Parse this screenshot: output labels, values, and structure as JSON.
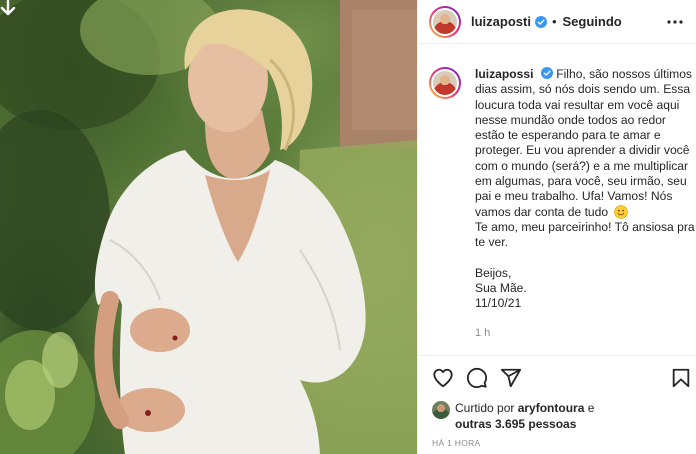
{
  "photo": {
    "alt_subject": "",
    "download_icon": "download-arrow-icon"
  },
  "post": {
    "username": "luizaposti",
    "follow_state": "Seguindo",
    "separator": "•",
    "verified_icon": "verified-badge-icon",
    "more_icon": "more-options-icon",
    "accent_color": "#3897f0"
  },
  "caption": {
    "username": "luizapossi",
    "lines": [
      " Filho, são nossos últimos",
      "dias assim, só nós dois sendo um. Essa",
      "loucura toda vai resultar em você aqui",
      "nesse mundão onde todos ao redor",
      "estão te esperando para te amar e",
      "proteger. Eu vou aprender a dividir você",
      "com o mundo (será?) e a me multiplicar",
      "em algumas, para você, seu irmão, seu",
      "pai e meu trabalho. Ufa! Vamos! Nós",
      "vamos dar conta de tudo",
      "Te amo, meu parceirinho! Tô ansiosa pra",
      "te ver."
    ],
    "sign_off": [
      "Beijos,",
      "Sua Mãe.",
      "11/10/21"
    ],
    "time_ago": "1 h",
    "emoji_icon": "smiling-face-emoji-icon"
  },
  "actions": {
    "like_icon": "heart-icon",
    "comment_icon": "comment-bubble-icon",
    "share_icon": "paper-plane-icon",
    "save_icon": "bookmark-icon"
  },
  "likes": {
    "prefix": "Curtido por ",
    "liker": "aryfontoura",
    "middle": " e",
    "others": "outras 3.695 pessoas"
  },
  "posted_ago": "HÁ 1 HORA"
}
